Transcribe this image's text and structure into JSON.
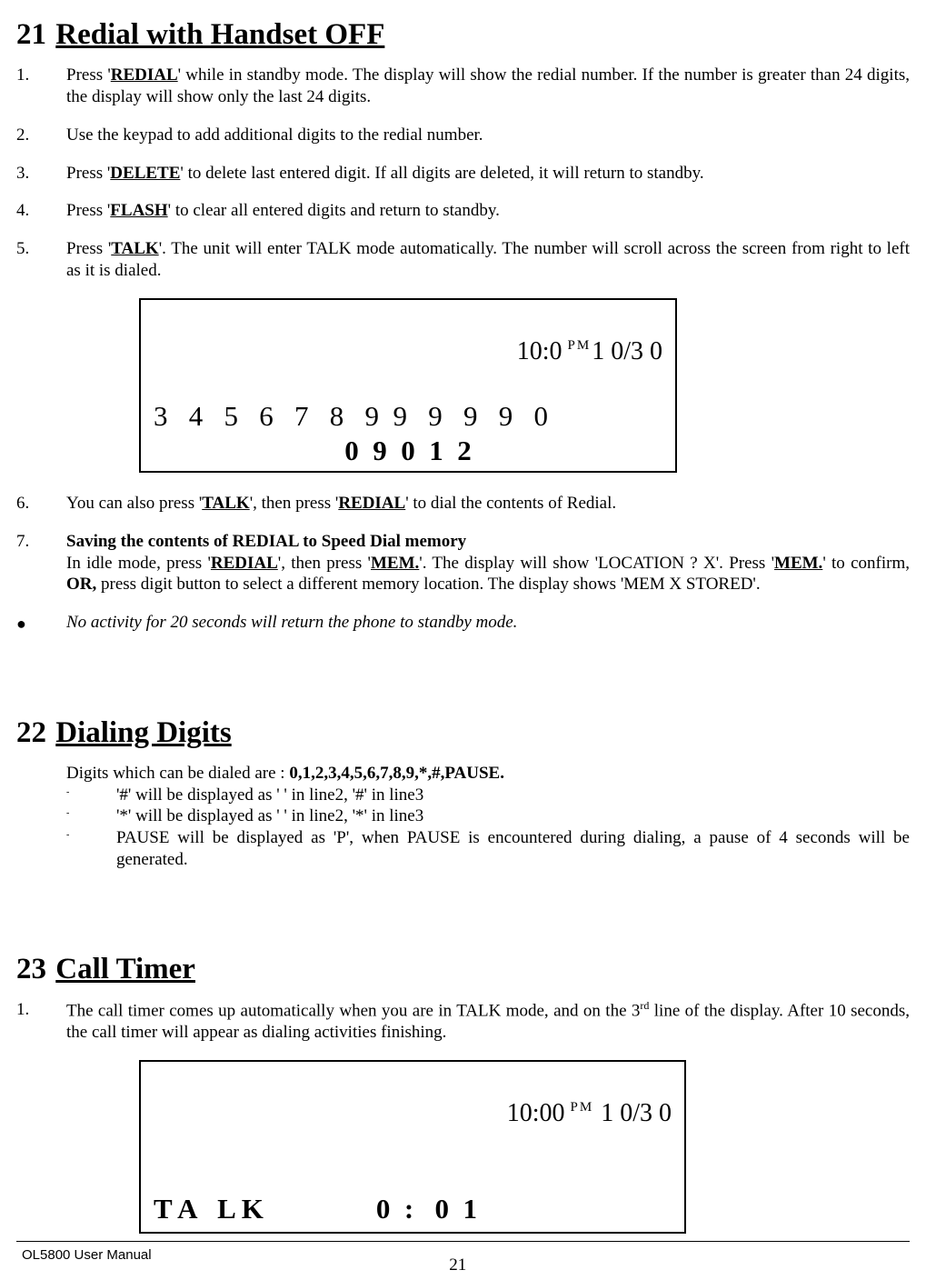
{
  "sections": {
    "s21": {
      "num": "21",
      "title": "Redial with Handset OFF",
      "items": [
        {
          "n": "1.",
          "parts": [
            {
              "t": "Press '"
            },
            {
              "t": "REDIAL",
              "cls": "boldu"
            },
            {
              "t": "' while in standby mode. The display will show the redial number. If the number is greater than 24 digits, the display will show only the last 24 digits."
            }
          ]
        },
        {
          "n": "2.",
          "parts": [
            {
              "t": "Use the keypad to add additional digits to the redial number."
            }
          ]
        },
        {
          "n": "3.",
          "parts": [
            {
              "t": "Press '"
            },
            {
              "t": "DELETE",
              "cls": "boldu"
            },
            {
              "t": "' to delete last entered digit. If all digits are deleted, it will return to standby."
            }
          ]
        },
        {
          "n": "4.",
          "parts": [
            {
              "t": "Press '"
            },
            {
              "t": "FLASH",
              "cls": "boldu"
            },
            {
              "t": "' to clear all entered digits and return to standby."
            }
          ]
        },
        {
          "n": "5.",
          "parts": [
            {
              "t": "Press '"
            },
            {
              "t": "TALK",
              "cls": "boldu"
            },
            {
              "t": "'. The unit will enter TALK mode automatically. The number will scroll across the screen from right to left as it is dialed."
            }
          ]
        },
        {
          "n": "6.",
          "parts": [
            {
              "t": "You can also press '"
            },
            {
              "t": "TALK",
              "cls": "boldu"
            },
            {
              "t": "', then press '"
            },
            {
              "t": "REDIAL",
              "cls": "boldu"
            },
            {
              "t": "' to dial the contents of Redial."
            }
          ]
        },
        {
          "n": "7.",
          "parts": [
            {
              "t": "Saving the contents of REDIAL to Speed Dial memory",
              "cls": "bold",
              "br": true
            },
            {
              "t": "In idle mode, press '"
            },
            {
              "t": "REDIAL",
              "cls": "boldu"
            },
            {
              "t": "', then press '"
            },
            {
              "t": "MEM.",
              "cls": "boldu"
            },
            {
              "t": "'.  The display will show 'LOCATION ?  X'.  Press '"
            },
            {
              "t": "MEM.",
              "cls": "boldu"
            },
            {
              "t": "' to confirm, "
            },
            {
              "t": "OR,",
              "cls": "bold"
            },
            {
              "t": "  press digit button to select a different memory location. The display shows  'MEM  X  STORED'."
            }
          ]
        }
      ],
      "bullet": "No activity for 20 seconds will return the phone to standby mode.",
      "lcd": {
        "line1_left": "10:0",
        "line1_pm": "PM",
        "line1_right": "1 0/3 0",
        "line2": "3   4   5   6   7   8   9  9   9   9   9   0",
        "line3": "0  9  0  1  2"
      }
    },
    "s22": {
      "num": "22",
      "title": "Dialing Digits     ",
      "intro_a": "Digits which can be dialed are : ",
      "intro_b": "0,1,2,3,4,5,6,7,8,9,*,#,PAUSE.",
      "dashes": [
        "'#' will be displayed as '   ' in line2, '#' in line3",
        "'*' will be displayed as '  ' in line2, '*' in line3",
        "PAUSE will be displayed as 'P', when PAUSE is encountered during dialing, a pause of 4 seconds will be generated."
      ]
    },
    "s23": {
      "num": "23",
      "title": "Call Timer",
      "item1_a": "The call timer comes up automatically when you are in TALK mode, and on the 3",
      "item1_sup": "rd",
      "item1_b": " line of the display. After 10 seconds, the call timer will appear as dialing activities finishing.",
      "lcd": {
        "line1_left": "10:00",
        "line1_pm": "PM",
        "line1_right": " 1 0/3 0",
        "line3": "T A   L K                0  :   0  1"
      }
    }
  },
  "footer": {
    "left": "OL5800 User Manual",
    "page": "21"
  }
}
